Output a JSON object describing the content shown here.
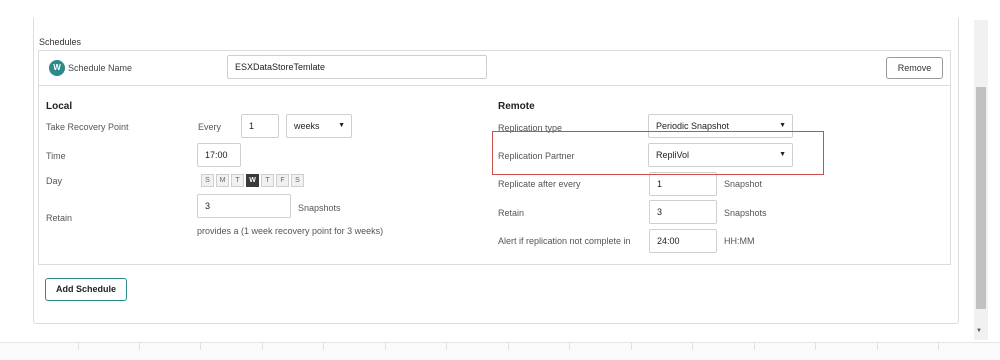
{
  "section": {
    "title": "Schedules"
  },
  "schedule": {
    "avatar_letter": "W",
    "name_label": "Schedule Name",
    "name_value": "ESXDataStoreTemlate",
    "remove_label": "Remove"
  },
  "local": {
    "title": "Local",
    "take_recovery_label": "Take Recovery Point",
    "every_label": "Every",
    "every_value": "1",
    "period_value": "weeks",
    "time_label": "Time",
    "time_value": "17:00",
    "day_label": "Day",
    "days": [
      {
        "letter": "S",
        "selected": false
      },
      {
        "letter": "M",
        "selected": false
      },
      {
        "letter": "T",
        "selected": false
      },
      {
        "letter": "W",
        "selected": true
      },
      {
        "letter": "T",
        "selected": false
      },
      {
        "letter": "F",
        "selected": false
      },
      {
        "letter": "S",
        "selected": false
      }
    ],
    "retain_label": "Retain",
    "retain_value": "3",
    "retain_unit": "Snapshots",
    "provides_text": "provides a (1 week recovery point for 3 weeks)"
  },
  "remote": {
    "title": "Remote",
    "replication_type_label": "Replication type",
    "replication_type_value": "Periodic Snapshot",
    "replication_partner_label": "Replication Partner",
    "replication_partner_value": "RepliVol",
    "replicate_after_label": "Replicate after every",
    "replicate_after_value": "1",
    "replicate_after_unit": "Snapshot",
    "retain_label": "Retain",
    "retain_value": "3",
    "retain_unit": "Snapshots",
    "alert_label": "Alert if replication not complete in",
    "alert_value": "24:00",
    "alert_unit": "HH:MM"
  },
  "actions": {
    "add_schedule_label": "Add Schedule"
  },
  "colors": {
    "accent": "#2d8a8a",
    "highlight": "#c9504a",
    "selected_day": "#3a3a3a"
  },
  "icons": {
    "dropdown": "chevron-down-icon"
  }
}
